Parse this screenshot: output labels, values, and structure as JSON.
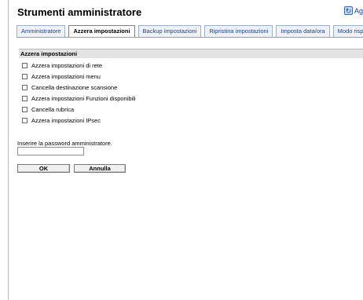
{
  "page": {
    "title": "Strumenti amministratore",
    "refresh_label": "Ag"
  },
  "tabs": [
    {
      "label": "Amministratore"
    },
    {
      "label": "Azzera impostazioni",
      "active": true
    },
    {
      "label": "Backup impostazioni"
    },
    {
      "label": "Ripristina impostazioni"
    },
    {
      "label": "Imposta data/ora"
    },
    {
      "label": "Modo risparmio ene"
    }
  ],
  "section": {
    "header": "Azzera impostazioni",
    "options": [
      {
        "label": "Azzera impostazioni di rete",
        "checked": false
      },
      {
        "label": "Azzera impostazioni menu",
        "checked": false
      },
      {
        "label": "Cancella destinazione scansione",
        "checked": false
      },
      {
        "label": "Azzera impostazioni Funzioni disponibili",
        "checked": false
      },
      {
        "label": "Cancella rubrica",
        "checked": false
      },
      {
        "label": "Azzera impostazioni IPsec",
        "checked": false
      }
    ]
  },
  "password": {
    "label": "Inserire la password amministratore.",
    "value": "",
    "placeholder": ""
  },
  "buttons": {
    "ok": "OK",
    "cancel": "Annulla"
  },
  "colors": {
    "tab_text": "#1b3f8a",
    "tab_bg": "#eef2f8",
    "section_header_bg": "#e3e3e3"
  },
  "icons": {
    "refresh": "refresh-icon"
  }
}
